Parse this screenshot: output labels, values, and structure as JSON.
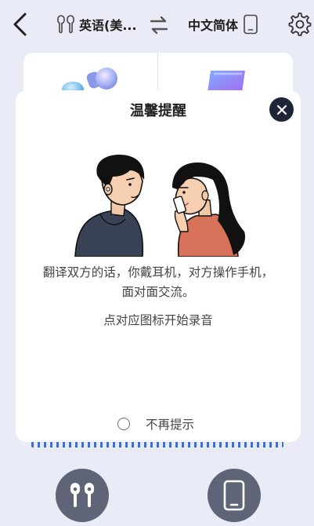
{
  "topbar": {
    "source_lang": "英语(美...",
    "target_lang": "中文简体",
    "icons": {
      "back": "chevron-left-icon",
      "earbuds": "earbuds-icon",
      "swap": "swap-arrows-icon",
      "phone": "phone-icon",
      "settings": "gear-icon"
    }
  },
  "dialog": {
    "title": "温馨提醒",
    "description": "翻译双方的话，你戴耳机，对方操作手机，面对面交流。",
    "hint": "点对应图标开始录音",
    "dont_remind_label": "不再提示",
    "dont_remind_checked": false
  },
  "bottom": {
    "left_button_icon": "earbuds-icon",
    "right_button_icon": "phone-icon"
  },
  "colors": {
    "background": "#e9ecf6",
    "dialog_bg": "#ffffff",
    "close_button": "#1f2437",
    "mic_button": "#5f6576",
    "wave": "#3b6fd8"
  }
}
